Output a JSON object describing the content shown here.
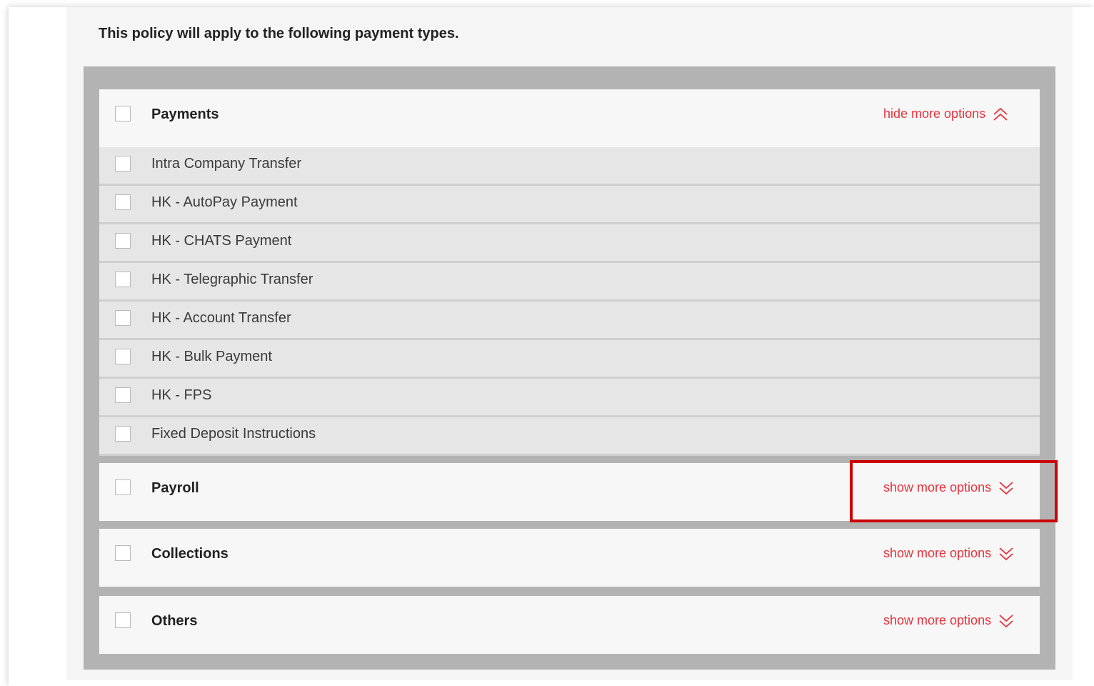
{
  "intro_text": "This policy will apply to the following payment types.",
  "colors": {
    "accent_red": "#e8323c",
    "highlight_red": "#cc0000",
    "panel_grey": "#b3b3b3"
  },
  "categories": [
    {
      "label": "Payments",
      "toggle_label": "hide more options",
      "toggle_icon": "chevron-double-up-icon",
      "expanded": true,
      "checked": false,
      "items": [
        "Intra Company Transfer",
        "HK - AutoPay Payment",
        "HK - CHATS Payment",
        "HK - Telegraphic Transfer",
        "HK - Account Transfer",
        "HK - Bulk Payment",
        "HK - FPS",
        "Fixed Deposit Instructions"
      ]
    },
    {
      "label": "Payroll",
      "toggle_label": "show more options",
      "toggle_icon": "chevron-double-down-icon",
      "expanded": false,
      "checked": false,
      "highlighted": true
    },
    {
      "label": "Collections",
      "toggle_label": "show more options",
      "toggle_icon": "chevron-double-down-icon",
      "expanded": false,
      "checked": false
    },
    {
      "label": "Others",
      "toggle_label": "show more options",
      "toggle_icon": "chevron-double-down-icon",
      "expanded": false,
      "checked": false
    }
  ]
}
